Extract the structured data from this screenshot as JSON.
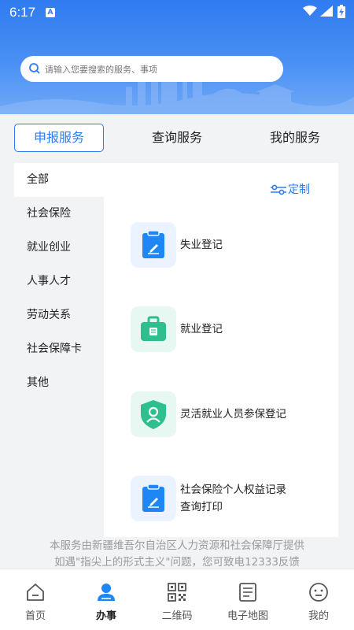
{
  "status_bar": {
    "time": "6:17",
    "notification_badge": "A",
    "icons": [
      "wifi-icon",
      "signal-icon",
      "battery-charging-icon"
    ]
  },
  "search": {
    "placeholder": "请输入您要搜索的服务、事项",
    "icon": "search-icon"
  },
  "tabs": [
    {
      "label": "申报服务",
      "active": true
    },
    {
      "label": "查询服务",
      "active": false
    },
    {
      "label": "我的服务",
      "active": false
    }
  ],
  "categories": [
    {
      "label": "全部",
      "active": true
    },
    {
      "label": "社会保险",
      "active": false
    },
    {
      "label": "就业创业",
      "active": false
    },
    {
      "label": "人事人才",
      "active": false
    },
    {
      "label": "劳动关系",
      "active": false
    },
    {
      "label": "社会保障卡",
      "active": false
    },
    {
      "label": "其他",
      "active": false
    }
  ],
  "customize_label": "定制",
  "services": [
    {
      "label": "失业登记",
      "icon": "clipboard-edit-icon",
      "color": "#1f86f5"
    },
    {
      "label": "就业登记",
      "icon": "briefcase-icon",
      "color": "#2fbf8f"
    },
    {
      "label": "灵活就业人员参保登记",
      "icon": "shield-person-icon",
      "color": "#2fbf8f"
    },
    {
      "label_line1": "社会保险个人权益记录",
      "label_line2": "查询打印",
      "icon": "clipboard-edit-icon",
      "color": "#1f86f5"
    }
  ],
  "footer": {
    "line1": "本服务由新疆维吾尔自治区人力资源和社会保障厅提供",
    "line2": "如遇\"指尖上的形式主义\"问题，您可致电12333反馈"
  },
  "bottom_nav": [
    {
      "label": "首页",
      "icon": "home-icon",
      "active": false
    },
    {
      "label": "办事",
      "icon": "person-icon",
      "active": true
    },
    {
      "label": "二维码",
      "icon": "qrcode-icon",
      "active": false
    },
    {
      "label": "电子地图",
      "icon": "document-map-icon",
      "active": false
    },
    {
      "label": "我的",
      "icon": "smiley-icon",
      "active": false
    }
  ],
  "colors": {
    "accent": "#2f7bf0",
    "green": "#2fbf8f",
    "header_top": "#2f7bf0"
  }
}
